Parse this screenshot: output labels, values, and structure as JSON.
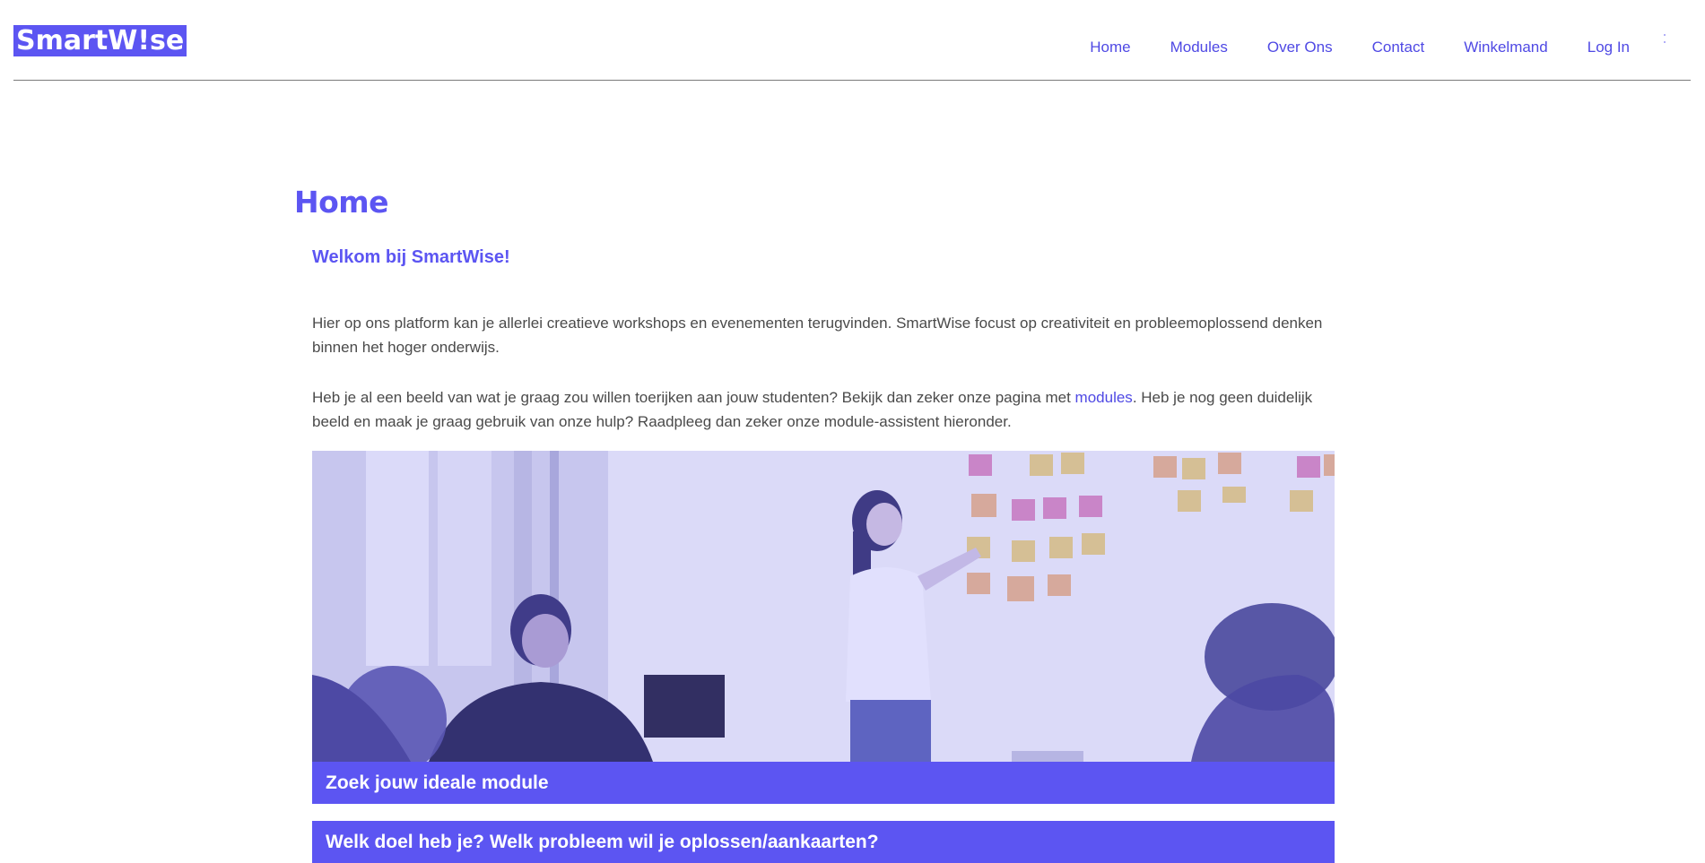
{
  "header": {
    "logo": "SmartW!se",
    "nav": [
      {
        "label": "Home"
      },
      {
        "label": "Modules"
      },
      {
        "label": "Over Ons"
      },
      {
        "label": "Contact"
      },
      {
        "label": "Winkelmand"
      },
      {
        "label": "Log In"
      }
    ]
  },
  "main": {
    "title": "Home",
    "welcome": "Welkom bij SmartWise!",
    "paragraph1": "Hier op ons platform kan je allerlei creatieve workshops en evenementen terugvinden. SmartWise focust op creativiteit en probleemoplossend denken binnen het hoger onderwijs.",
    "paragraph2_before": "Heb je al een beeld van wat je graag zou willen toerijken aan jouw studenten? Bekijk dan zeker onze pagina met ",
    "paragraph2_link": "modules",
    "paragraph2_after": ". Heb je nog geen duidelijk beeld en maak je graag gebruik van onze hulp? Raadpleeg dan zeker onze module-assistent hieronder.",
    "assistant": {
      "title": "Zoek jouw ideale module",
      "question": "Welk doel heb je? Welk probleem wil je oplossen/aankaarten?"
    }
  },
  "colors": {
    "brand": "#5c55f2",
    "link": "#4f49e4",
    "text": "#4a4a4a",
    "divider": "#7a7a7a"
  }
}
